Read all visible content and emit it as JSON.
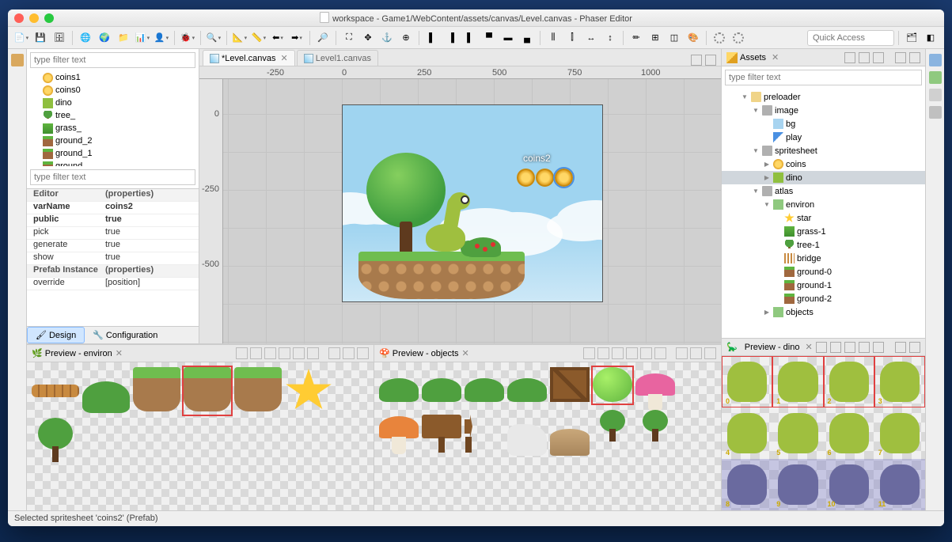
{
  "window": {
    "title": "workspace - Game1/WebContent/assets/canvas/Level.canvas - Phaser Editor",
    "quick_access_placeholder": "Quick Access"
  },
  "editor_tabs": {
    "active": "*Level.canvas",
    "inactive": "Level1.canvas"
  },
  "filter_placeholder": "type filter text",
  "outline": [
    {
      "icon": "ico-coin",
      "label": "coins1"
    },
    {
      "icon": "ico-coin",
      "label": "coins0"
    },
    {
      "icon": "ico-dino",
      "label": "dino"
    },
    {
      "icon": "ico-tree",
      "label": "tree_"
    },
    {
      "icon": "ico-grass",
      "label": "grass_"
    },
    {
      "icon": "ico-ground",
      "label": "ground_2"
    },
    {
      "icon": "ico-ground",
      "label": "ground_1"
    },
    {
      "icon": "ico-ground",
      "label": "ground_"
    }
  ],
  "props": {
    "editor_head_k": "Editor",
    "editor_head_v": "(properties)",
    "varName_k": "varName",
    "varName_v": "coins2",
    "public_k": "public",
    "public_v": "true",
    "pick_k": "pick",
    "pick_v": "true",
    "generate_k": "generate",
    "generate_v": "true",
    "show_k": "show",
    "show_v": "true",
    "prefab_head_k": "Prefab Instance",
    "prefab_head_v": "(properties)",
    "override_k": "override",
    "override_v": "[position]"
  },
  "bottom_tabs": {
    "design": "Design",
    "config": "Configuration"
  },
  "canvas": {
    "ruler_h": {
      "m250": "-250",
      "z": "0",
      "p250": "250",
      "p500": "500",
      "p750": "750",
      "p1000": "1000"
    },
    "ruler_v": {
      "z": "0",
      "m250": "-250",
      "m500": "-500"
    },
    "coins_label": "coins2"
  },
  "assets": {
    "title": "Assets",
    "tree": [
      {
        "d": 1,
        "arr": "▼",
        "ico": "aico-folder",
        "label": "preloader"
      },
      {
        "d": 2,
        "arr": "▼",
        "ico": "aico-sect",
        "label": "image"
      },
      {
        "d": 3,
        "arr": "",
        "ico": "aico-img",
        "label": "bg"
      },
      {
        "d": 3,
        "arr": "",
        "ico": "aico-play",
        "label": "play"
      },
      {
        "d": 2,
        "arr": "▼",
        "ico": "aico-sect",
        "label": "spritesheet"
      },
      {
        "d": 3,
        "arr": "▶",
        "ico": "ico-coin",
        "label": "coins"
      },
      {
        "d": 3,
        "arr": "▶",
        "ico": "ico-dino",
        "label": "dino",
        "sel": true
      },
      {
        "d": 2,
        "arr": "▼",
        "ico": "aico-sect",
        "label": "atlas"
      },
      {
        "d": 3,
        "arr": "▼",
        "ico": "aico-objects",
        "label": "environ"
      },
      {
        "d": 4,
        "arr": "",
        "ico": "aico-star",
        "label": "star"
      },
      {
        "d": 4,
        "arr": "",
        "ico": "ico-grass",
        "label": "grass-1"
      },
      {
        "d": 4,
        "arr": "",
        "ico": "ico-tree",
        "label": "tree-1"
      },
      {
        "d": 4,
        "arr": "",
        "ico": "aico-bridge",
        "label": "bridge"
      },
      {
        "d": 4,
        "arr": "",
        "ico": "ico-ground",
        "label": "ground-0"
      },
      {
        "d": 4,
        "arr": "",
        "ico": "ico-ground",
        "label": "ground-1"
      },
      {
        "d": 4,
        "arr": "",
        "ico": "ico-ground",
        "label": "ground-2"
      },
      {
        "d": 3,
        "arr": "▶",
        "ico": "aico-objects",
        "label": "objects"
      }
    ]
  },
  "preview_dino": {
    "title": "Preview - dino"
  },
  "preview_environ": {
    "title": "Preview - environ"
  },
  "preview_objects": {
    "title": "Preview - objects"
  },
  "status": "Selected spritesheet 'coins2' (Prefab)"
}
